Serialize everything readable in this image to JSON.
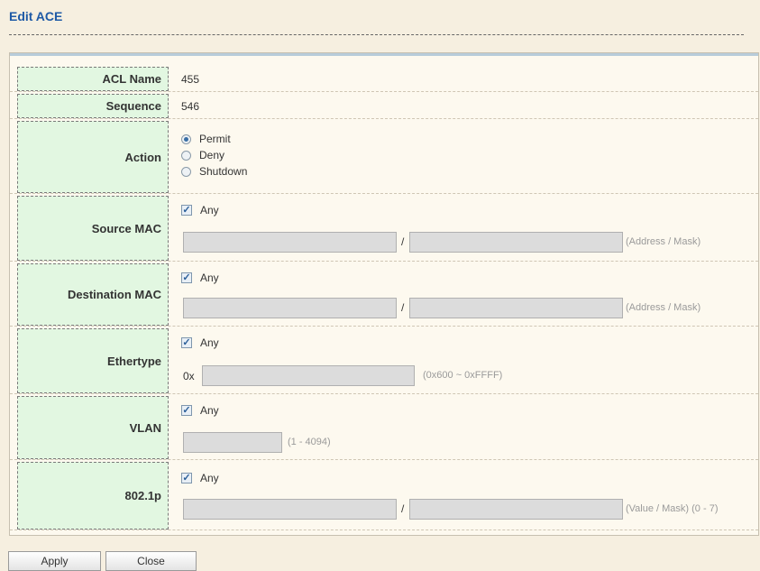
{
  "title": "Edit ACE",
  "fields": {
    "acl_name": {
      "label": "ACL Name",
      "value": "455"
    },
    "sequence": {
      "label": "Sequence",
      "value": "546"
    },
    "action": {
      "label": "Action",
      "options": [
        "Permit",
        "Deny",
        "Shutdown"
      ],
      "selected": "Permit"
    },
    "source_mac": {
      "label": "Source MAC",
      "any_label": "Any",
      "any_checked": true,
      "separator": "/",
      "hint": "(Address / Mask)",
      "address": "",
      "mask": ""
    },
    "destination_mac": {
      "label": "Destination MAC",
      "any_label": "Any",
      "any_checked": true,
      "separator": "/",
      "hint": "(Address / Mask)",
      "address": "",
      "mask": ""
    },
    "ethertype": {
      "label": "Ethertype",
      "any_label": "Any",
      "any_checked": true,
      "prefix": "0x",
      "hint": "(0x600 ~ 0xFFFF)",
      "value": ""
    },
    "vlan": {
      "label": "VLAN",
      "any_label": "Any",
      "any_checked": true,
      "hint": "(1 - 4094)",
      "value": ""
    },
    "dot1p": {
      "label": "802.1p",
      "any_label": "Any",
      "any_checked": true,
      "separator": "/",
      "hint": "(Value / Mask) (0 - 7)",
      "value": "",
      "mask": ""
    }
  },
  "buttons": {
    "apply": "Apply",
    "close": "Close"
  }
}
